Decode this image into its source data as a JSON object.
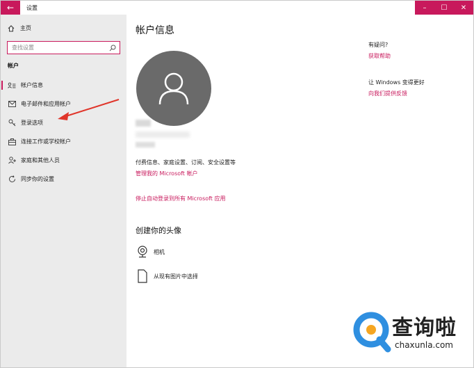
{
  "window": {
    "title": "设置",
    "back_icon": "arrow-left-icon",
    "controls": {
      "minimize": "–",
      "maximize": "☐",
      "close": "✕"
    },
    "accent": "#c8195c"
  },
  "sidebar": {
    "home_label": "主页",
    "search_placeholder": "查找设置",
    "section_label": "帐户",
    "items": [
      {
        "label": "帐户信息",
        "icon": "person-card-icon",
        "active": true
      },
      {
        "label": "电子邮件和应用帐户",
        "icon": "mail-icon",
        "active": false
      },
      {
        "label": "登录选项",
        "icon": "key-icon",
        "active": false
      },
      {
        "label": "连接工作或学校帐户",
        "icon": "briefcase-icon",
        "active": false
      },
      {
        "label": "家庭和其他人员",
        "icon": "person-add-icon",
        "active": false
      },
      {
        "label": "同步你的设置",
        "icon": "sync-icon",
        "active": false
      }
    ]
  },
  "main": {
    "title": "帐户信息",
    "blurred_name": "",
    "info_text": "付费信息、家庭设置、订阅、安全设置等",
    "manage_link": "管理我的 Microsoft 帐户",
    "stop_auto_link": "停止自动登录到所有 Microsoft 应用",
    "create_avatar_heading": "创建你的头像",
    "camera_label": "相机",
    "browse_label": "从现有图片中选择"
  },
  "right_panel": {
    "question_label": "有疑问?",
    "help_link": "获取帮助",
    "improve_label": "让 Windows 变得更好",
    "feedback_link": "向我们提供反馈"
  },
  "watermark": {
    "text": "查询啦",
    "url": "chaxunla.com",
    "ring_color": "#2f8fe0",
    "dot_color": "#f5a623"
  }
}
